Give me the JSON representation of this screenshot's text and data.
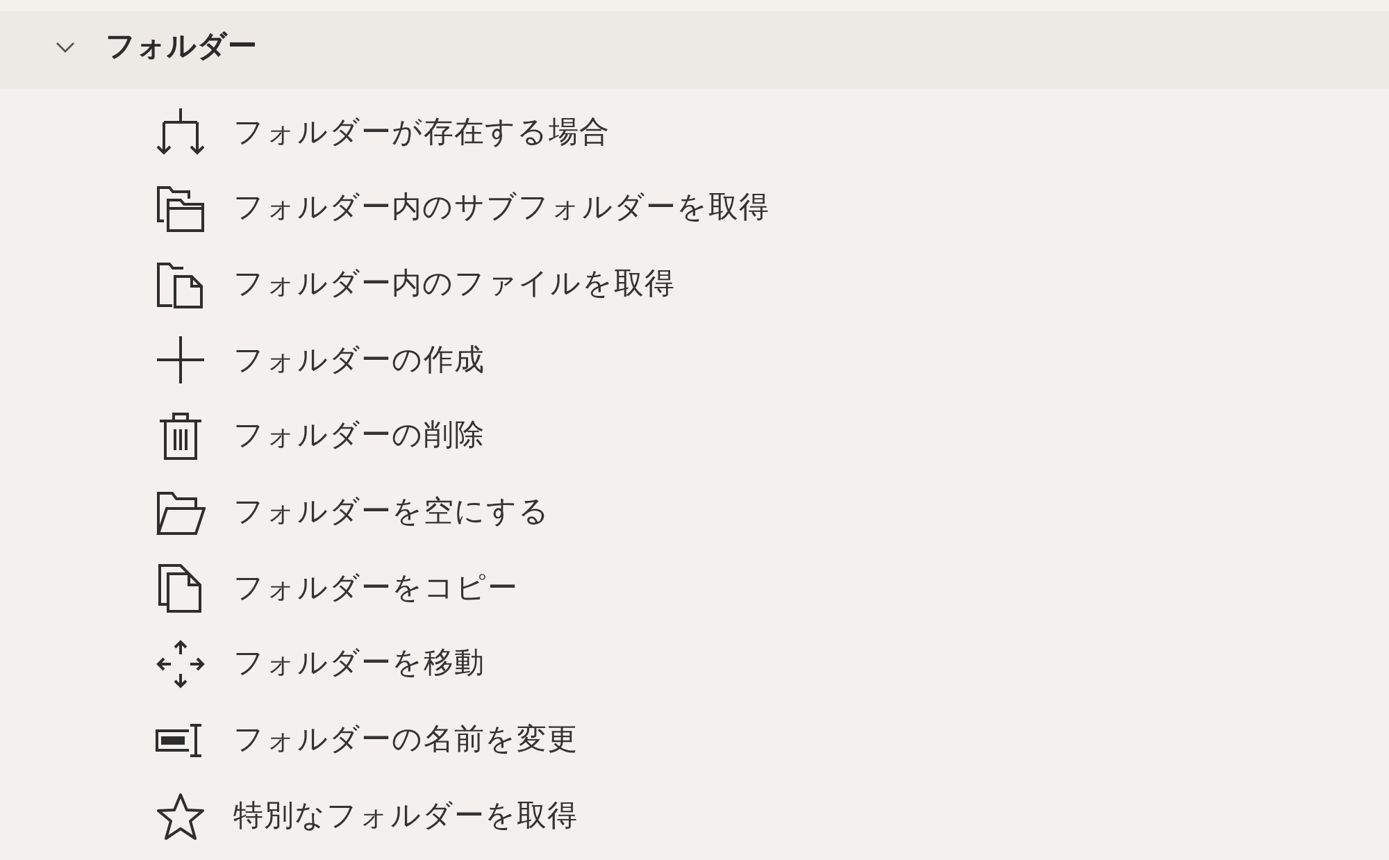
{
  "group": {
    "title": "フォルダー",
    "expanded": true,
    "items": [
      {
        "label": "フォルダーが存在する場合"
      },
      {
        "label": "フォルダー内のサブフォルダーを取得"
      },
      {
        "label": "フォルダー内のファイルを取得"
      },
      {
        "label": "フォルダーの作成"
      },
      {
        "label": "フォルダーの削除"
      },
      {
        "label": "フォルダーを空にする"
      },
      {
        "label": "フォルダーをコピー"
      },
      {
        "label": "フォルダーを移動"
      },
      {
        "label": "フォルダーの名前を変更"
      },
      {
        "label": "特別なフォルダーを取得"
      }
    ]
  }
}
